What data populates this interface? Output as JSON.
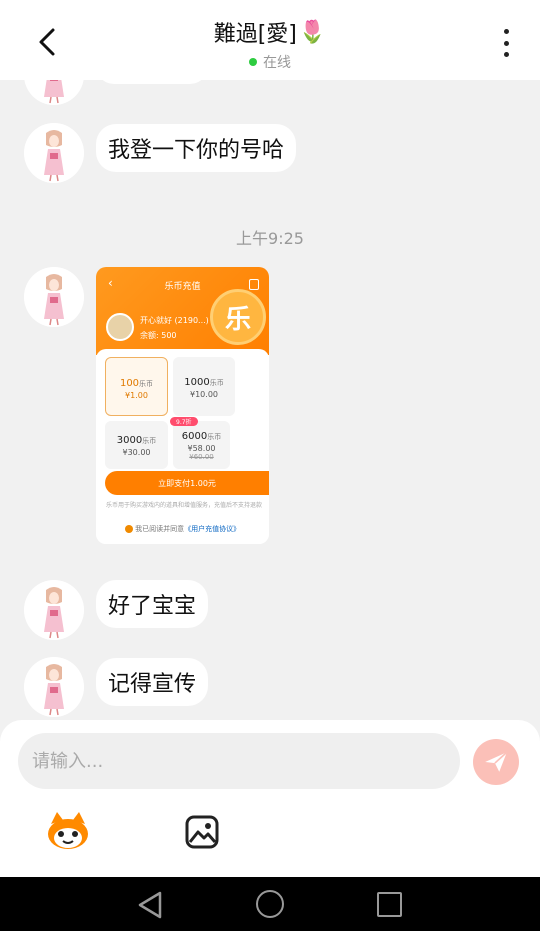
{
  "header": {
    "title": "難過[愛]",
    "title_emoji": "🌷",
    "status": "在线",
    "status_color": "#2ecc40",
    "back_icon": "chevron-left-icon",
    "more_icon": "vertical-dots-icon"
  },
  "messages": [
    {
      "type": "text",
      "text": "我登一下你的号哈"
    },
    {
      "type": "timestamp",
      "text": "上午9:25"
    },
    {
      "type": "image",
      "screen": {
        "nav_title": "乐币充值",
        "coin_glyph": "乐",
        "user_name": "开心就好",
        "user_id": "(2190...)",
        "balance": "余额: 500",
        "packages": [
          {
            "amount": "100",
            "unit": "乐币",
            "price": "¥1.00",
            "selected": true
          },
          {
            "amount": "1000",
            "unit": "乐币",
            "price": "¥10.00"
          },
          {
            "amount": "3000",
            "unit": "乐币",
            "price": "¥30.00"
          },
          {
            "amount": "6000",
            "unit": "乐币",
            "price": "¥58.00",
            "tag": "9.7折",
            "original": "¥60.00"
          }
        ],
        "pay_label": "立即支付1.00元",
        "note": "乐币用于购买游戏内的道具和增值服务，充值后不支持退款",
        "agree_prefix": "我已阅读并同意",
        "agree_link": "《用户充值协议》"
      }
    },
    {
      "type": "text",
      "text": "好了宝宝"
    },
    {
      "type": "text",
      "text": "记得宣传"
    }
  ],
  "input": {
    "placeholder": "请输入..."
  },
  "toolbar": {
    "send_icon": "send-icon",
    "emoji_icon": "mascot-emoji-icon",
    "image_icon": "image-icon"
  },
  "colors": {
    "accent": "#ff7f00",
    "send_bg": "#fbc0b8",
    "background": "#f1f1f1"
  }
}
